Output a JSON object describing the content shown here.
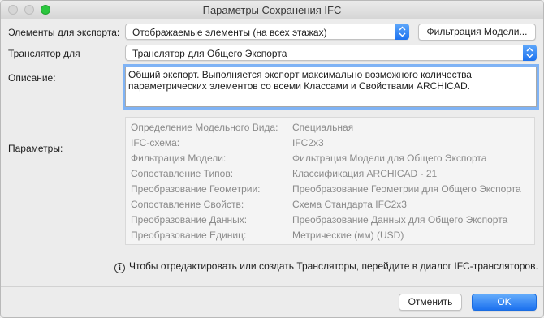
{
  "window": {
    "title": "Параметры Сохранения IFC"
  },
  "export_elements": {
    "label": "Элементы для экспорта:",
    "value": "Отображаемые элементы (на всех этажах)",
    "filter_button": "Фильтрация Модели..."
  },
  "translator": {
    "label": "Транслятор для",
    "value": "Транслятор для Общего Экспорта"
  },
  "description": {
    "label": "Описание:",
    "text": "Общий экспорт. Выполняется экспорт максимально возможного количества параметрических элементов со всеми Классами и Свойствами ARCHICAD."
  },
  "parameters": {
    "label": "Параметры:",
    "rows": [
      {
        "key": "Определение Модельного Вида:",
        "value": "Специальная"
      },
      {
        "key": "IFC-схема:",
        "value": "IFC2x3"
      },
      {
        "key": "Фильтрация Модели:",
        "value": "Фильтрация Модели для Общего Экспорта"
      },
      {
        "key": "Сопоставление Типов:",
        "value": "Классификация ARCHICAD - 21"
      },
      {
        "key": "Преобразование Геометрии:",
        "value": "Преобразование Геометрии для Общего Экспорта"
      },
      {
        "key": "Сопоставление Свойств:",
        "value": "Схема Стандарта IFC2x3"
      },
      {
        "key": "Преобразование Данных:",
        "value": "Преобразование Данных для Общего Экспорта"
      },
      {
        "key": "Преобразование Единиц:",
        "value": "Метрические (мм) (USD)"
      }
    ]
  },
  "info": {
    "text": "Чтобы отредактировать или создать Трансляторы, перейдите в диалог IFC-трансляторов."
  },
  "footer": {
    "cancel": "Отменить",
    "ok": "OK"
  },
  "colors": {
    "accent": "#1d72ef",
    "focus_ring": "#7fb3f5",
    "close_green": "#2bc63e"
  },
  "icons": [
    "close-light",
    "minimize-light",
    "zoom-green",
    "stepper-arrows",
    "info-circle"
  ]
}
